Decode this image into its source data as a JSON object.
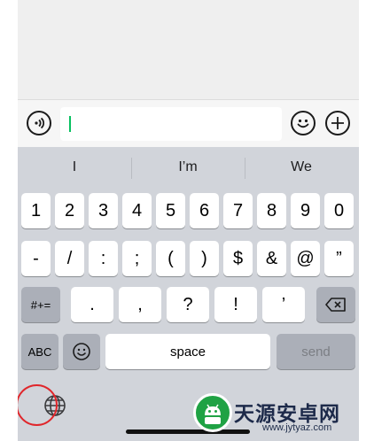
{
  "suggestions": [
    "I",
    "I’m",
    "We"
  ],
  "keys": {
    "row1": [
      "1",
      "2",
      "3",
      "4",
      "5",
      "6",
      "7",
      "8",
      "9",
      "0"
    ],
    "row2": [
      "-",
      "/",
      ":",
      ";",
      "(",
      ")",
      "$",
      "&",
      "@",
      "”"
    ],
    "row3_mode": "#+=",
    "row3": [
      ".",
      ",",
      "?",
      "!",
      "’"
    ],
    "abc": "ABC",
    "space": "space",
    "send": "send"
  },
  "colors": {
    "accent_caret": "#07c160",
    "highlight_ring": "#e0262b"
  },
  "icons": {
    "voice": "voice-input-icon",
    "emoji": "emoji-icon",
    "add": "plus-circle-icon",
    "delete": "backspace-icon",
    "keyboard_emoji": "emoji-key-icon",
    "globe": "globe-icon"
  },
  "watermark": {
    "title": "天源安卓网",
    "url": "www.jytyaz.com"
  }
}
